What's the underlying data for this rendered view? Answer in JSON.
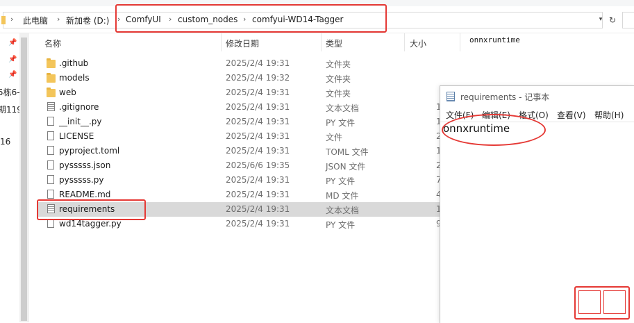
{
  "address": {
    "crumbs": [
      "此电脑",
      "新加卷 (D:)",
      "ComfyUI",
      "custom_nodes",
      "comfyui-WD14-Tagger"
    ]
  },
  "nav": {
    "texts": [
      "5栋6-",
      "期119",
      "16"
    ]
  },
  "columns": {
    "name": "名称",
    "date": "修改日期",
    "type": "类型",
    "size": "大小"
  },
  "files": [
    {
      "name": ".github",
      "date": "2025/2/4 19:31",
      "type": "文件夹",
      "size": "",
      "icon": "folder-icon"
    },
    {
      "name": "models",
      "date": "2025/2/4 19:32",
      "type": "文件夹",
      "size": "",
      "icon": "folder-icon"
    },
    {
      "name": "web",
      "date": "2025/2/4 19:31",
      "type": "文件夹",
      "size": "",
      "icon": "folder-icon"
    },
    {
      "name": ".gitignore",
      "date": "2025/2/4 19:31",
      "type": "文本文档",
      "size": "1",
      "icon": "text-file-icon"
    },
    {
      "name": "__init__.py",
      "date": "2025/2/4 19:31",
      "type": "PY 文件",
      "size": "1",
      "icon": "file-icon"
    },
    {
      "name": "LICENSE",
      "date": "2025/2/4 19:31",
      "type": "文件",
      "size": "2",
      "icon": "file-icon"
    },
    {
      "name": "pyproject.toml",
      "date": "2025/2/4 19:31",
      "type": "TOML 文件",
      "size": "1",
      "icon": "file-icon"
    },
    {
      "name": "pysssss.json",
      "date": "2025/6/6 19:35",
      "type": "JSON 文件",
      "size": "2",
      "icon": "file-icon"
    },
    {
      "name": "pysssss.py",
      "date": "2025/2/4 19:31",
      "type": "PY 文件",
      "size": "7",
      "icon": "file-icon"
    },
    {
      "name": "README.md",
      "date": "2025/2/4 19:31",
      "type": "MD 文件",
      "size": "4",
      "icon": "file-icon"
    },
    {
      "name": "requirements",
      "date": "2025/2/4 19:31",
      "type": "文本文档",
      "size": "1",
      "icon": "text-file-icon",
      "selected": true
    },
    {
      "name": "wd14tagger.py",
      "date": "2025/2/4 19:31",
      "type": "PY 文件",
      "size": "9",
      "icon": "file-icon"
    }
  ],
  "preview": {
    "text": "onnxruntime"
  },
  "notepad": {
    "title": "requirements - 记事本",
    "menu": [
      "文件(F)",
      "编辑(E)",
      "格式(O)",
      "查看(V)",
      "帮助(H)"
    ],
    "content": "onnxruntime"
  },
  "colors": {
    "highlight_red": "#e53935",
    "selected_row": "#d9d9d9",
    "folder": "#f3c55a"
  }
}
